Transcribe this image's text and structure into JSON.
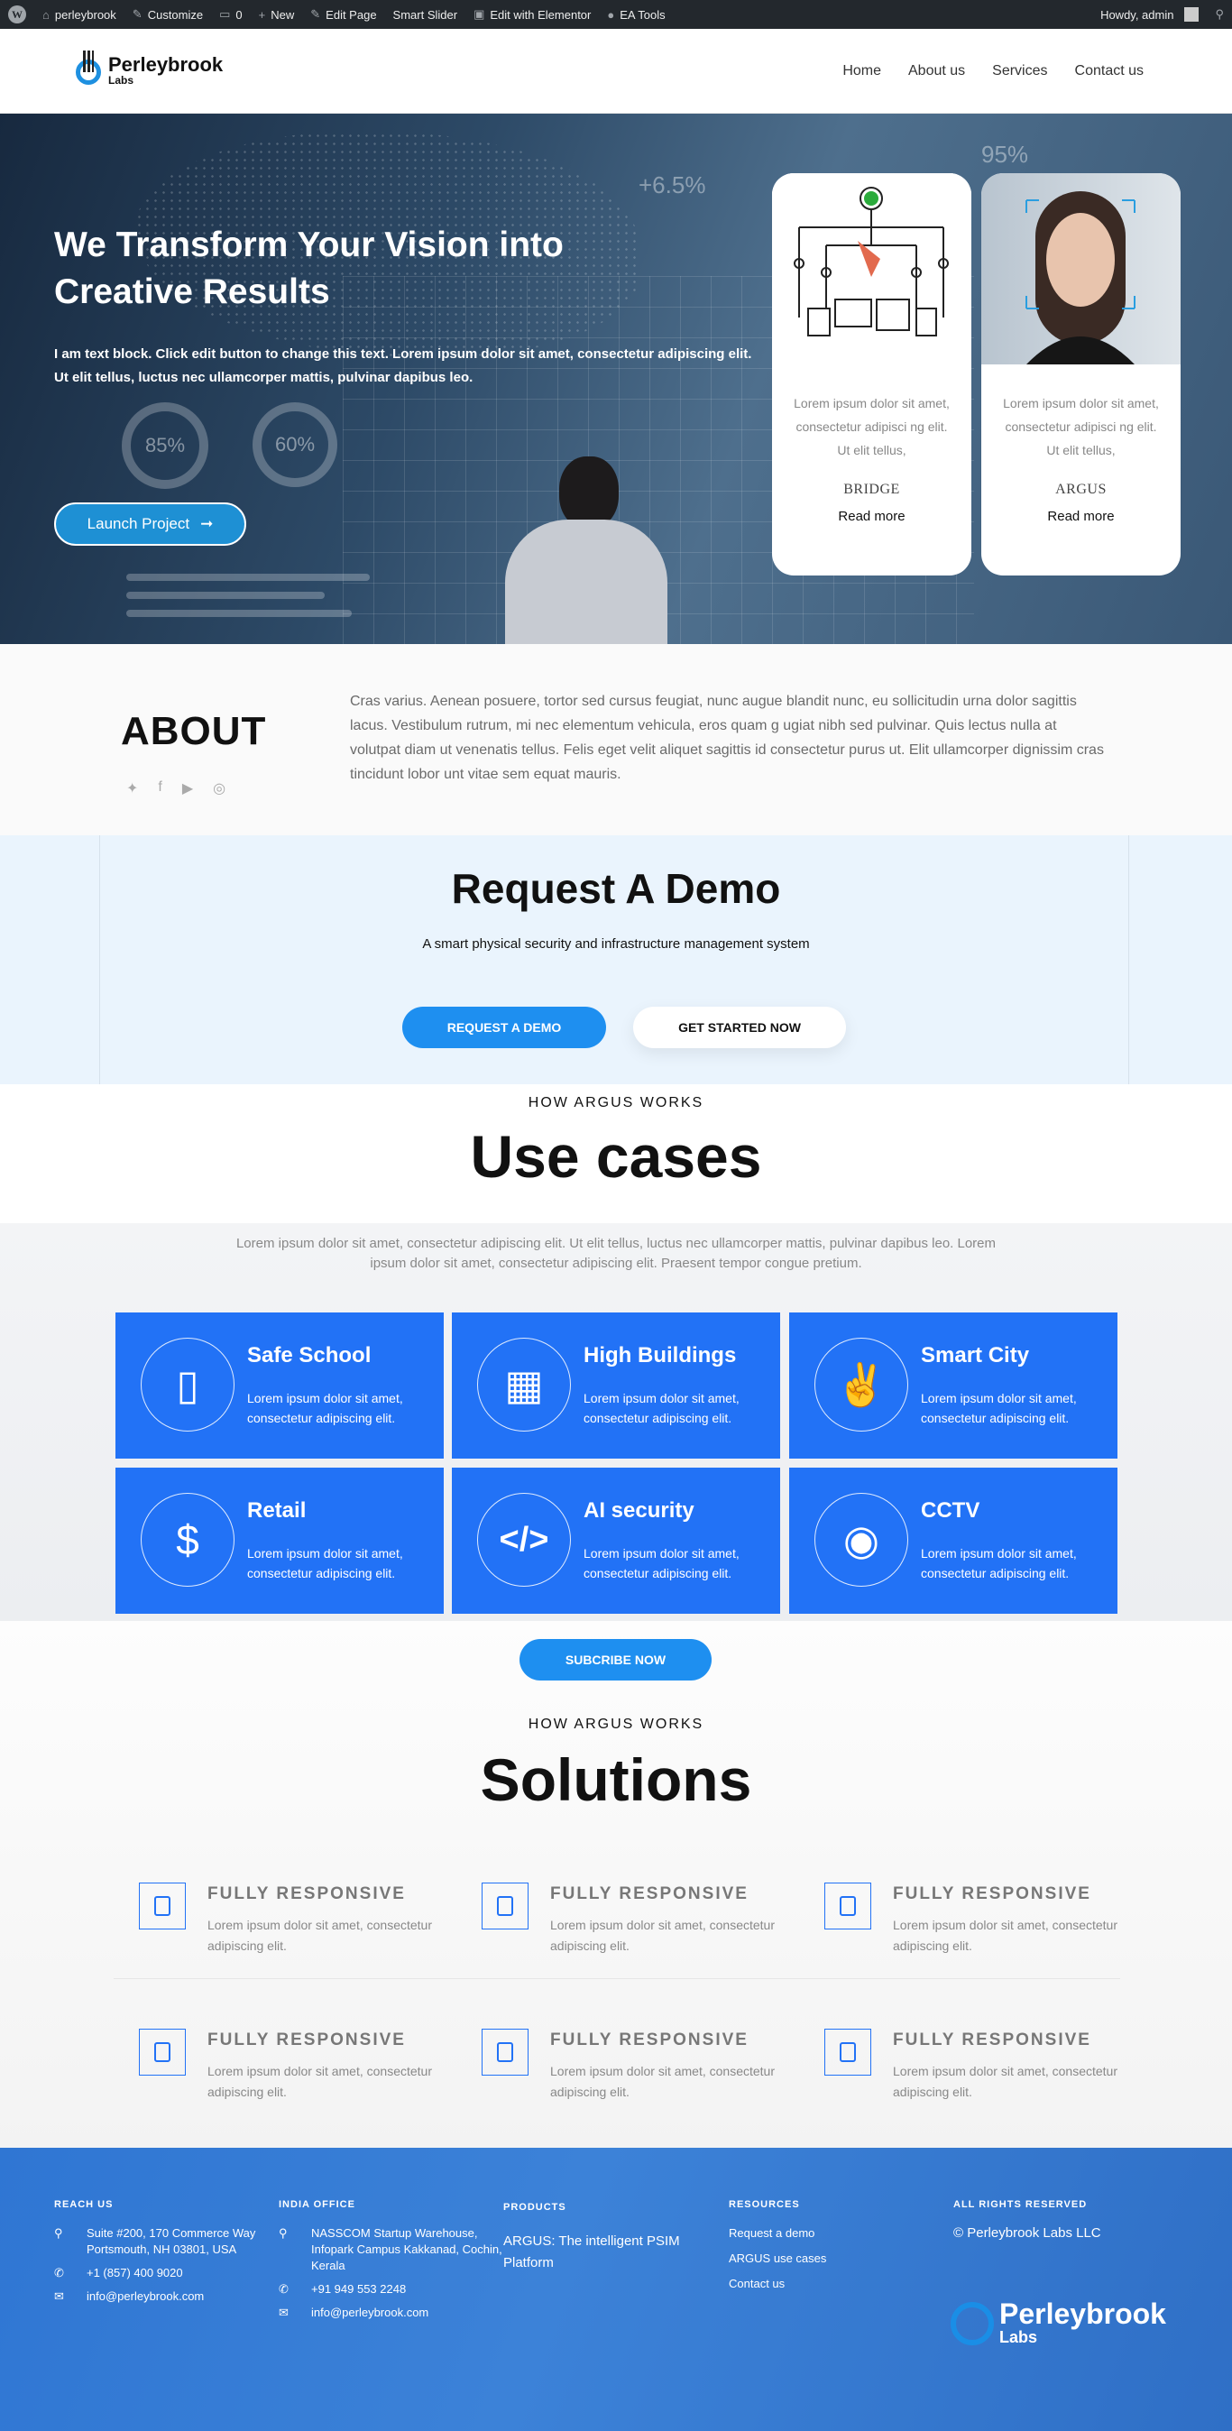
{
  "adminbar": {
    "site": "perleybrook",
    "customize": "Customize",
    "comments": "0",
    "new": "New",
    "edit_page": "Edit Page",
    "smart_slider": "Smart Slider",
    "elementor": "Edit with Elementor",
    "ea_tools": "EA Tools",
    "howdy": "Howdy, admin"
  },
  "header": {
    "logo_line1": "Perleybrook",
    "logo_line2": "Labs",
    "nav": [
      "Home",
      "About us",
      "Services",
      "Contact us"
    ]
  },
  "hero": {
    "title": "We Transform Your Vision into Creative Results",
    "text": "I am text block. Click edit button to change this text. Lorem ipsum dolor sit amet, consectetur adipiscing elit. Ut elit tellus, luctus nec ullamcorper mattis, pulvinar dapibus leo.",
    "button": "Launch Project",
    "bg_stats": [
      "+6.5%",
      "95%",
      "85%",
      "60%"
    ],
    "cards": [
      {
        "text": "Lorem ipsum dolor sit amet, consectetur adipisci ng elit. Ut elit tellus,",
        "title": "BRIDGE",
        "more": "Read more"
      },
      {
        "text": "Lorem ipsum dolor sit amet, consectetur adipisci ng elit. Ut elit tellus,",
        "title": "ARGUS",
        "more": "Read more"
      }
    ]
  },
  "about": {
    "heading": "ABOUT",
    "text": "Cras varius. Aenean posuere, tortor sed cursus feugiat, nunc augue blandit nunc, eu sollicitudin urna dolor sagittis lacus. Vestibulum rutrum, mi nec elementum vehicula, eros quam g ugiat nibh sed pulvinar. Quis lectus nulla at volutpat diam ut venenatis tellus. Felis eget velit aliquet sagittis id consectetur purus ut. Elit ullamcorper dignissim cras tincidunt lobor unt vitae sem equat mauris.",
    "socials": [
      "twitter-icon",
      "facebook-icon",
      "youtube-icon",
      "instagram-icon"
    ]
  },
  "demo": {
    "heading": "Request A Demo",
    "subtitle": "A smart physical security and infrastructure management system",
    "btn_primary": "REQUEST A DEMO",
    "btn_secondary": "GET STARTED NOW"
  },
  "usecases": {
    "kicker": "HOW ARGUS WORKS",
    "heading": "Use cases",
    "intro": "Lorem ipsum dolor sit amet, consectetur adipiscing elit. Ut elit tellus, luctus nec ullamcorper mattis, pulvinar dapibus leo. Lorem ipsum dolor sit amet, consectetur adipiscing elit. Praesent tempor congue pretium.",
    "tiles": [
      {
        "title": "Safe School",
        "desc": "Lorem ipsum dolor sit amet, consectetur adipiscing elit.",
        "icon": "mobile-icon"
      },
      {
        "title": "High Buildings",
        "desc": "Lorem ipsum dolor sit amet, consectetur adipiscing elit.",
        "icon": "building-icon"
      },
      {
        "title": "Smart City",
        "desc": "Lorem ipsum dolor sit amet, consectetur adipiscing elit.",
        "icon": "hand-peace-icon"
      },
      {
        "title": "Retail",
        "desc": "Lorem ipsum dolor sit amet, consectetur adipiscing elit.",
        "icon": "comments-dollar-icon"
      },
      {
        "title": "AI security",
        "desc": "Lorem ipsum dolor sit amet, consectetur adipiscing elit.",
        "icon": "code-icon"
      },
      {
        "title": "CCTV",
        "desc": "Lorem ipsum dolor sit amet, consectetur adipiscing elit.",
        "icon": "camera-icon"
      }
    ]
  },
  "solutions": {
    "subscribe": "SUBCRIBE NOW",
    "kicker": "HOW ARGUS WORKS",
    "heading": "Solutions",
    "features": [
      {
        "title": "FULLY RESPONSIVE",
        "desc": "Lorem ipsum dolor sit amet, consectetur adipiscing elit."
      },
      {
        "title": "FULLY RESPONSIVE",
        "desc": "Lorem ipsum dolor sit amet, consectetur adipiscing elit."
      },
      {
        "title": "FULLY RESPONSIVE",
        "desc": "Lorem ipsum dolor sit amet, consectetur adipiscing elit."
      },
      {
        "title": "FULLY RESPONSIVE",
        "desc": "Lorem ipsum dolor sit amet, consectetur adipiscing elit."
      },
      {
        "title": "FULLY RESPONSIVE",
        "desc": "Lorem ipsum dolor sit amet, consectetur adipiscing elit."
      },
      {
        "title": "FULLY RESPONSIVE",
        "desc": "Lorem ipsum dolor sit amet, consectetur adipiscing elit."
      }
    ]
  },
  "footer": {
    "reach_heading": "REACH US",
    "reach_address": "Suite #200, 170 Commerce Way Portsmouth, NH 03801, USA",
    "reach_phone": "+1 (857) 400 9020",
    "reach_email": "info@perleybrook.com",
    "india_heading": "INDIA OFFICE",
    "india_address": "NASSCOM Startup Warehouse, Infopark Campus Kakkanad, Cochin, Kerala",
    "india_phone": "+91 949 553 2248",
    "india_email": "info@perleybrook.com",
    "products_heading": "PRODUCTS",
    "products_item": "ARGUS: The intelligent PSIM Platform",
    "resources_heading": "RESOURCES",
    "resources": [
      "Request a demo",
      "ARGUS use cases",
      "Contact us"
    ],
    "rights_heading": "ALL RIGHTS RESERVED",
    "rights_text": "© Perleybrook Labs LLC",
    "logo_line1": "Perleybrook",
    "logo_line2": "Labs"
  }
}
